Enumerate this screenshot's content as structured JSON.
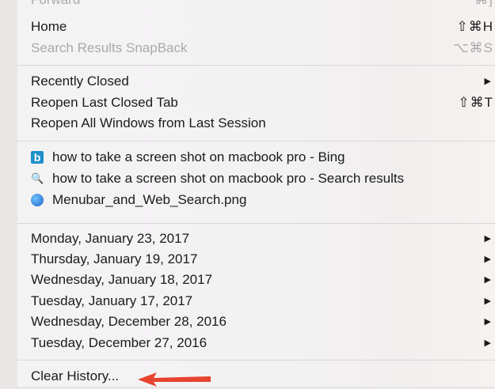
{
  "menu": {
    "top_partial": {
      "label": "Forward",
      "shortcut": "⌘]"
    },
    "home": {
      "label": "Home",
      "shortcut": "⇧⌘H"
    },
    "snapback": {
      "label": "Search Results SnapBack",
      "shortcut": "⌥⌘S"
    },
    "recently_closed": {
      "label": "Recently Closed",
      "arrow": "▶"
    },
    "reopen_last": {
      "label": "Reopen Last Closed Tab",
      "shortcut": "⇧⌘T"
    },
    "reopen_all": {
      "label": "Reopen All Windows from Last Session"
    },
    "history_items": [
      {
        "label": "how to take a screen shot on macbook pro - Bing",
        "icon": "bing-icon",
        "icon_glyph": "b"
      },
      {
        "label": "how to take a screen shot on macbook pro - Search results",
        "icon": "magnifier-icon",
        "icon_glyph": "🔍"
      },
      {
        "label": "Menubar_and_Web_Search.png",
        "icon": "globe-icon",
        "icon_glyph": ""
      }
    ],
    "dates": [
      {
        "label": "Monday, January 23, 2017",
        "arrow": "▶"
      },
      {
        "label": "Thursday, January 19, 2017",
        "arrow": "▶"
      },
      {
        "label": "Wednesday, January 18, 2017",
        "arrow": "▶"
      },
      {
        "label": "Tuesday, January 17, 2017",
        "arrow": "▶"
      },
      {
        "label": "Wednesday, December 28, 2016",
        "arrow": "▶"
      },
      {
        "label": "Tuesday, December 27, 2016",
        "arrow": "▶"
      }
    ],
    "clear_history": {
      "label": "Clear History..."
    }
  },
  "colors": {
    "accent_arrow": "#e8432f",
    "bing": "#1e8fcb",
    "disabled": "#aaa9ab"
  }
}
